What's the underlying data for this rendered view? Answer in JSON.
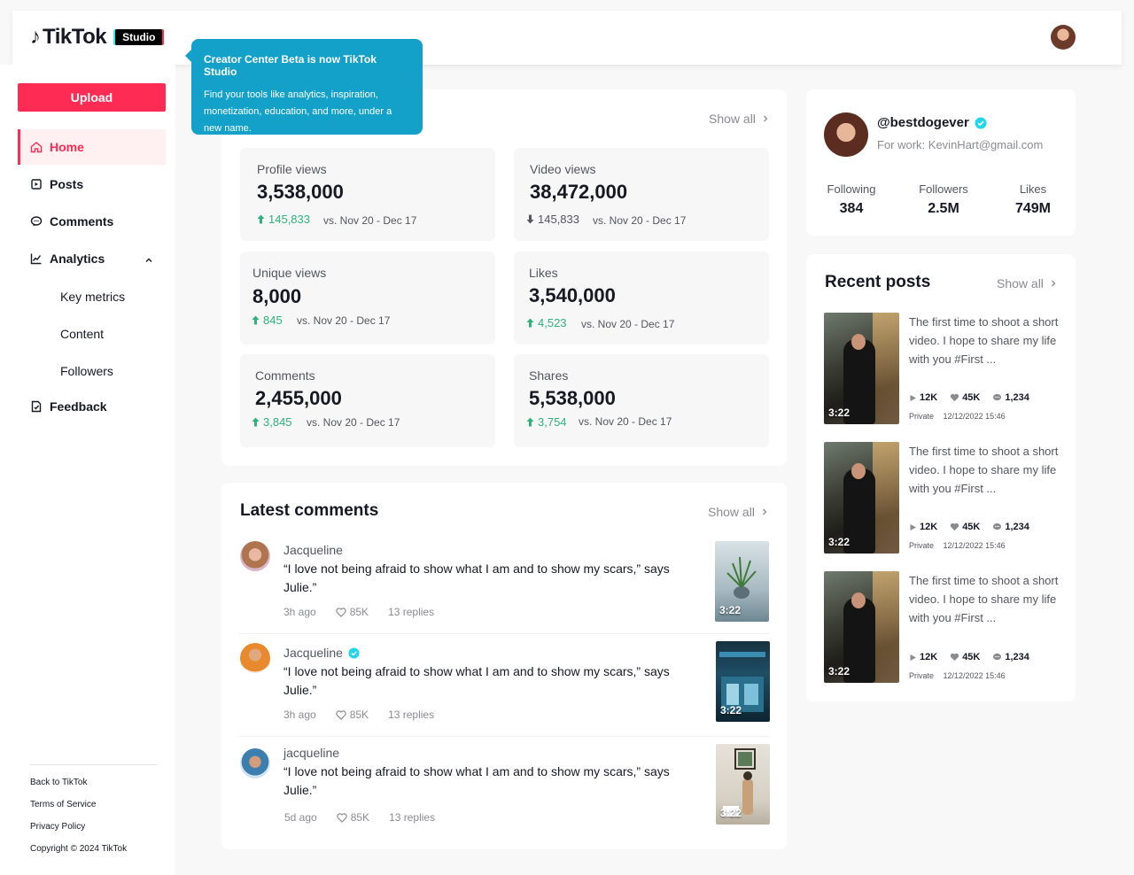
{
  "brand": {
    "logo_text": "TikTok",
    "badge": "Studio",
    "accent": "#fe2c55"
  },
  "tooltip": {
    "title": "Creator Center Beta is now TikTok Studio",
    "body": "Find your tools like analytics, inspiration, monetization, education, and more, under a new name."
  },
  "sidebar": {
    "upload_label": "Upload",
    "items": [
      {
        "label": "Home",
        "icon": "home-icon"
      },
      {
        "label": "Posts",
        "icon": "posts-icon"
      },
      {
        "label": "Comments",
        "icon": "comments-icon"
      },
      {
        "label": "Analytics",
        "icon": "analytics-icon"
      },
      {
        "label": "Feedback",
        "icon": "feedback-icon"
      }
    ],
    "analytics_sub": [
      "Key metrics",
      "Content",
      "Followers"
    ],
    "footer": [
      "Back to TikTok",
      "Terms of Service",
      "Privacy Policy",
      "Copyright © 2024 TikTok"
    ]
  },
  "overview": {
    "show_all": "Show all",
    "metrics": [
      {
        "label": "Profile views",
        "value": "3,538,000",
        "delta": "145,833",
        "trend": "up",
        "range": "vs. Nov 20 - Dec 17"
      },
      {
        "label": "Video views",
        "value": "38,472,000",
        "delta": "145,833",
        "trend": "down",
        "range": "vs. Nov 20 - Dec 17"
      },
      {
        "label": "Unique views",
        "value": "8,000",
        "delta": "845",
        "trend": "up",
        "range": "vs. Nov 20 - Dec 17"
      },
      {
        "label": "Likes",
        "value": "3,540,000",
        "delta": "4,523",
        "trend": "up",
        "range": "vs. Nov 20 - Dec 17"
      },
      {
        "label": "Comments",
        "value": "2,455,000",
        "delta": "3,845",
        "trend": "up",
        "range": "vs. Nov 20 - Dec 17"
      },
      {
        "label": "Shares",
        "value": "5,538,000",
        "delta": "3,754",
        "trend": "up",
        "range": "vs. Nov 20 - Dec 17"
      }
    ]
  },
  "comments": {
    "title": "Latest comments",
    "show_all": "Show all",
    "items": [
      {
        "name": "Jacqueline",
        "verified": false,
        "text": "“I love not being afraid to show what I am and to show my scars,” says Julie.”",
        "time": "3h ago",
        "likes": "85K",
        "replies": "13 replies",
        "duration": "3:22"
      },
      {
        "name": "Jacqueline",
        "verified": true,
        "text": "“I love not being afraid to show what I am and to show my scars,” says Julie.”",
        "time": "3h ago",
        "likes": "85K",
        "replies": "13 replies",
        "duration": "3:22"
      },
      {
        "name": "jacqueline",
        "verified": false,
        "text": "“I love not being afraid to show what I am and to show my scars,” says Julie.”",
        "time": "5d ago",
        "likes": "85K",
        "replies": "13 replies",
        "duration": "3:22"
      }
    ]
  },
  "profile": {
    "handle": "@bestdogever",
    "work": "For work: KevinHart@gmail.com",
    "stats": [
      {
        "label": "Following",
        "value": "384"
      },
      {
        "label": "Followers",
        "value": "2.5M"
      },
      {
        "label": "Likes",
        "value": "749M"
      }
    ]
  },
  "recent_posts": {
    "title": "Recent posts",
    "show_all": "Show all",
    "items": [
      {
        "text": "The first time to shoot a short video. I hope to share my life with you #First ...",
        "plays": "12K",
        "likes": "45K",
        "comments": "1,234",
        "visibility": "Private",
        "date": "12/12/2022 15:46",
        "duration": "3:22"
      },
      {
        "text": "The first time to shoot a short video. I hope to share my life with you #First ...",
        "plays": "12K",
        "likes": "45K",
        "comments": "1,234",
        "visibility": "Private",
        "date": "12/12/2022 15:46",
        "duration": "3:22"
      },
      {
        "text": "The first time to shoot a short video. I hope to share my life with you #First ...",
        "plays": "12K",
        "likes": "45K",
        "comments": "1,234",
        "visibility": "Private",
        "date": "12/12/2022 15:46",
        "duration": "3:22"
      }
    ]
  }
}
